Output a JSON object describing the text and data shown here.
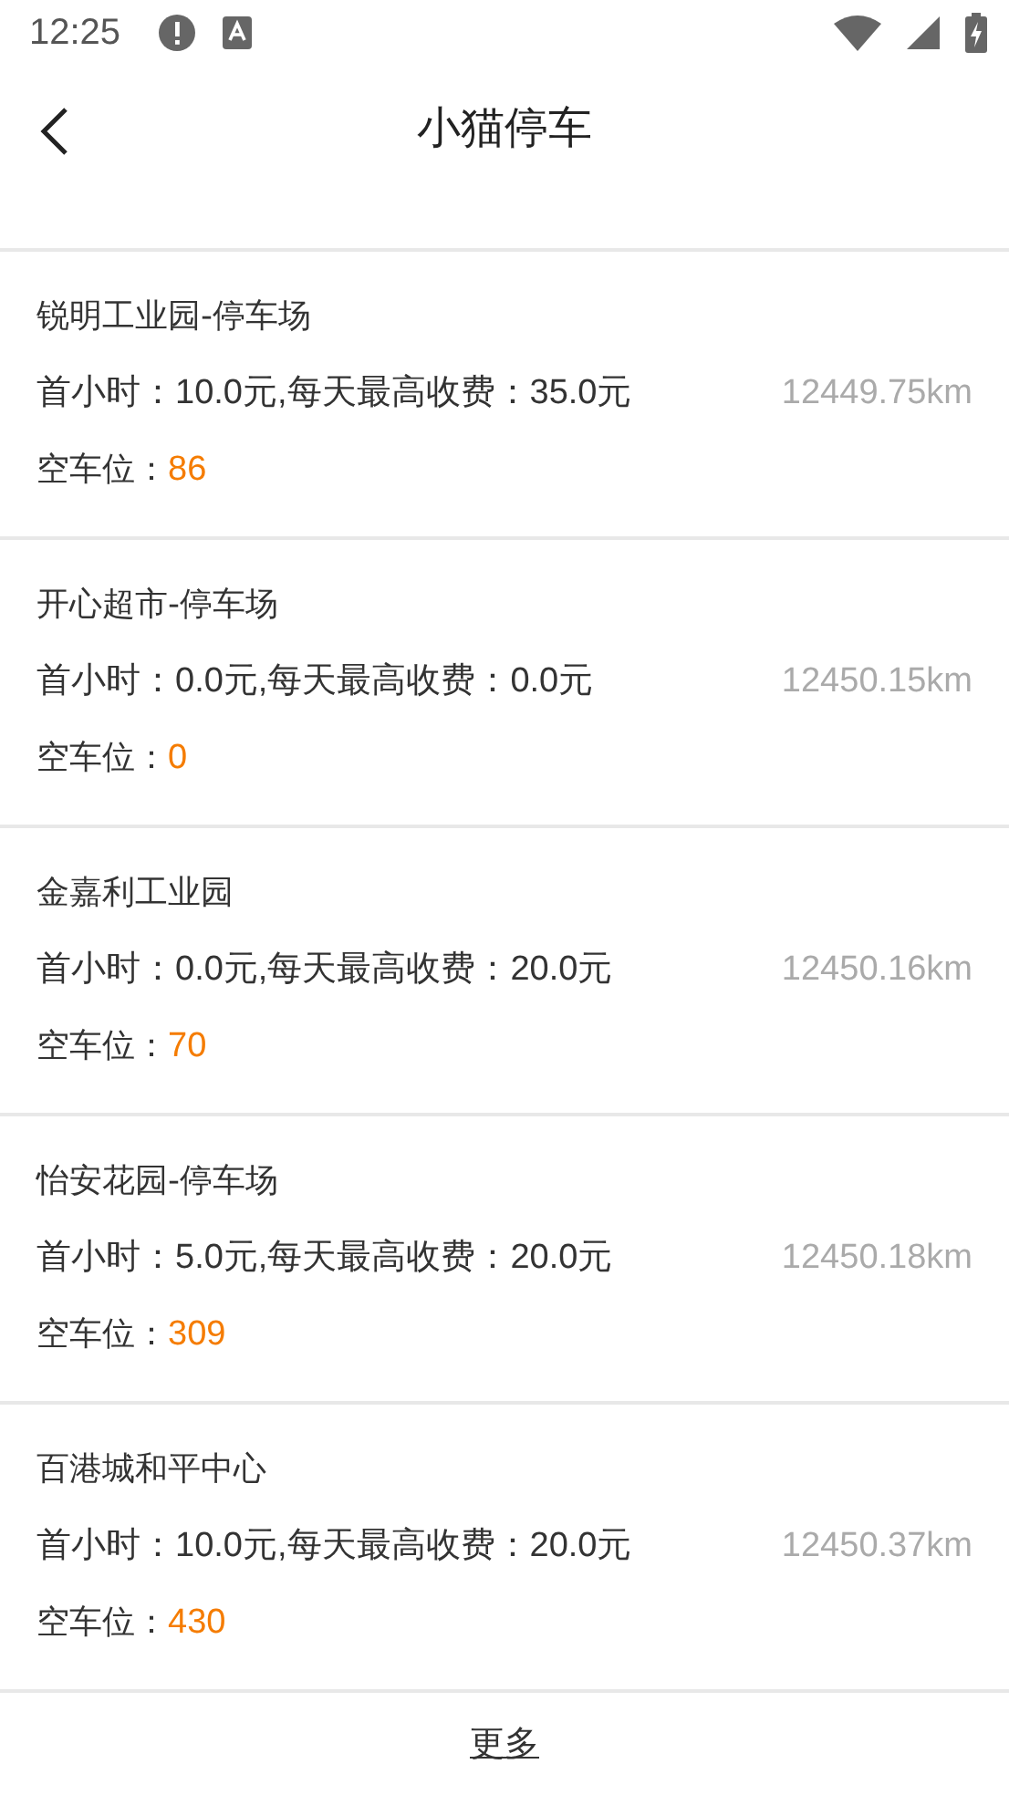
{
  "status_bar": {
    "time": "12:25"
  },
  "header": {
    "title": "小猫停车"
  },
  "parking_lots": [
    {
      "name": "锐明工业园-停车场",
      "fee": "首小时：10.0元,每天最高收费：35.0元",
      "spaces_label": "空车位：",
      "spaces": "86",
      "distance": "12449.75km"
    },
    {
      "name": "开心超市-停车场",
      "fee": "首小时：0.0元,每天最高收费：0.0元",
      "spaces_label": "空车位：",
      "spaces": "0",
      "distance": "12450.15km"
    },
    {
      "name": "金嘉利工业园",
      "fee": "首小时：0.0元,每天最高收费：20.0元",
      "spaces_label": "空车位：",
      "spaces": "70",
      "distance": "12450.16km"
    },
    {
      "name": "怡安花园-停车场",
      "fee": "首小时：5.0元,每天最高收费：20.0元",
      "spaces_label": "空车位：",
      "spaces": "309",
      "distance": "12450.18km"
    },
    {
      "name": "百港城和平中心",
      "fee": "首小时：10.0元,每天最高收费：20.0元",
      "spaces_label": "空车位：",
      "spaces": "430",
      "distance": "12450.37km"
    }
  ],
  "more_link": "更多"
}
